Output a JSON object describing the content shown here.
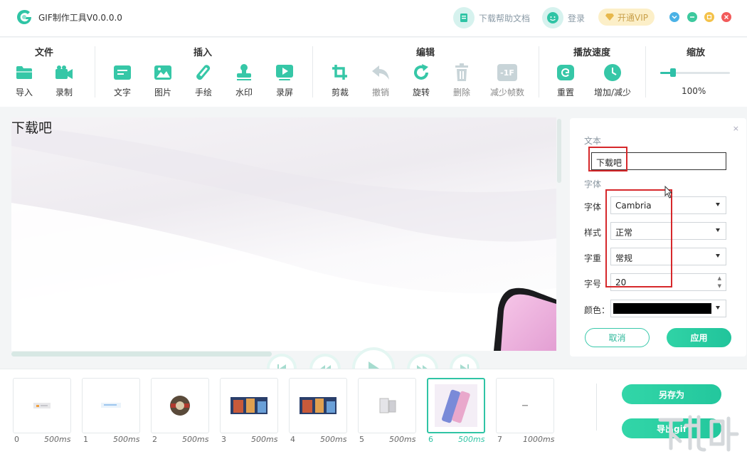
{
  "app": {
    "title": "GIF制作工具V0.0.0.0"
  },
  "header": {
    "help_docs": "下载帮助文档",
    "login": "登录",
    "vip": "开通VIP",
    "colors": {
      "minimize": "#4bb2e6",
      "maximize": "#f4c24a",
      "close": "#f25b5b"
    }
  },
  "toolbar": {
    "groups": {
      "file": "文件",
      "insert": "插入",
      "edit": "编辑",
      "speed": "播放速度",
      "zoom": "缩放"
    },
    "tools": {
      "import": "导入",
      "record": "录制",
      "text": "文字",
      "image": "图片",
      "draw": "手绘",
      "watermark": "水印",
      "screen_record": "录屏",
      "crop": "剪裁",
      "undo": "撤销",
      "rotate": "旋转",
      "delete": "删除",
      "reduce_frames": "减少帧数",
      "reduce_frames_icon": "-1F",
      "reset": "重置",
      "speed_adjust": "增加/减少"
    },
    "zoom_value": "100%",
    "zoom_fraction": 0.18
  },
  "canvas": {
    "overlay_text": "下载吧"
  },
  "panel": {
    "text_section": "文本",
    "text_value": "下载吧",
    "font_section": "字体",
    "font_label": "字体",
    "font_value": "Cambria",
    "style_label": "样式",
    "style_value": "正常",
    "weight_label": "字重",
    "weight_value": "常规",
    "size_label": "字号",
    "size_value": "20",
    "color_label": "颜色：",
    "color_value": "#000000",
    "cancel": "取消",
    "apply": "应用",
    "close": "×"
  },
  "frames": [
    {
      "index": "0",
      "duration": "500ms"
    },
    {
      "index": "1",
      "duration": "500ms"
    },
    {
      "index": "2",
      "duration": "500ms"
    },
    {
      "index": "3",
      "duration": "500ms"
    },
    {
      "index": "4",
      "duration": "500ms"
    },
    {
      "index": "5",
      "duration": "500ms"
    },
    {
      "index": "6",
      "duration": "500ms",
      "selected": true
    },
    {
      "index": "7",
      "duration": "1000ms"
    }
  ],
  "actions": {
    "save_as": "另存为",
    "export_gif": "导出gif"
  }
}
